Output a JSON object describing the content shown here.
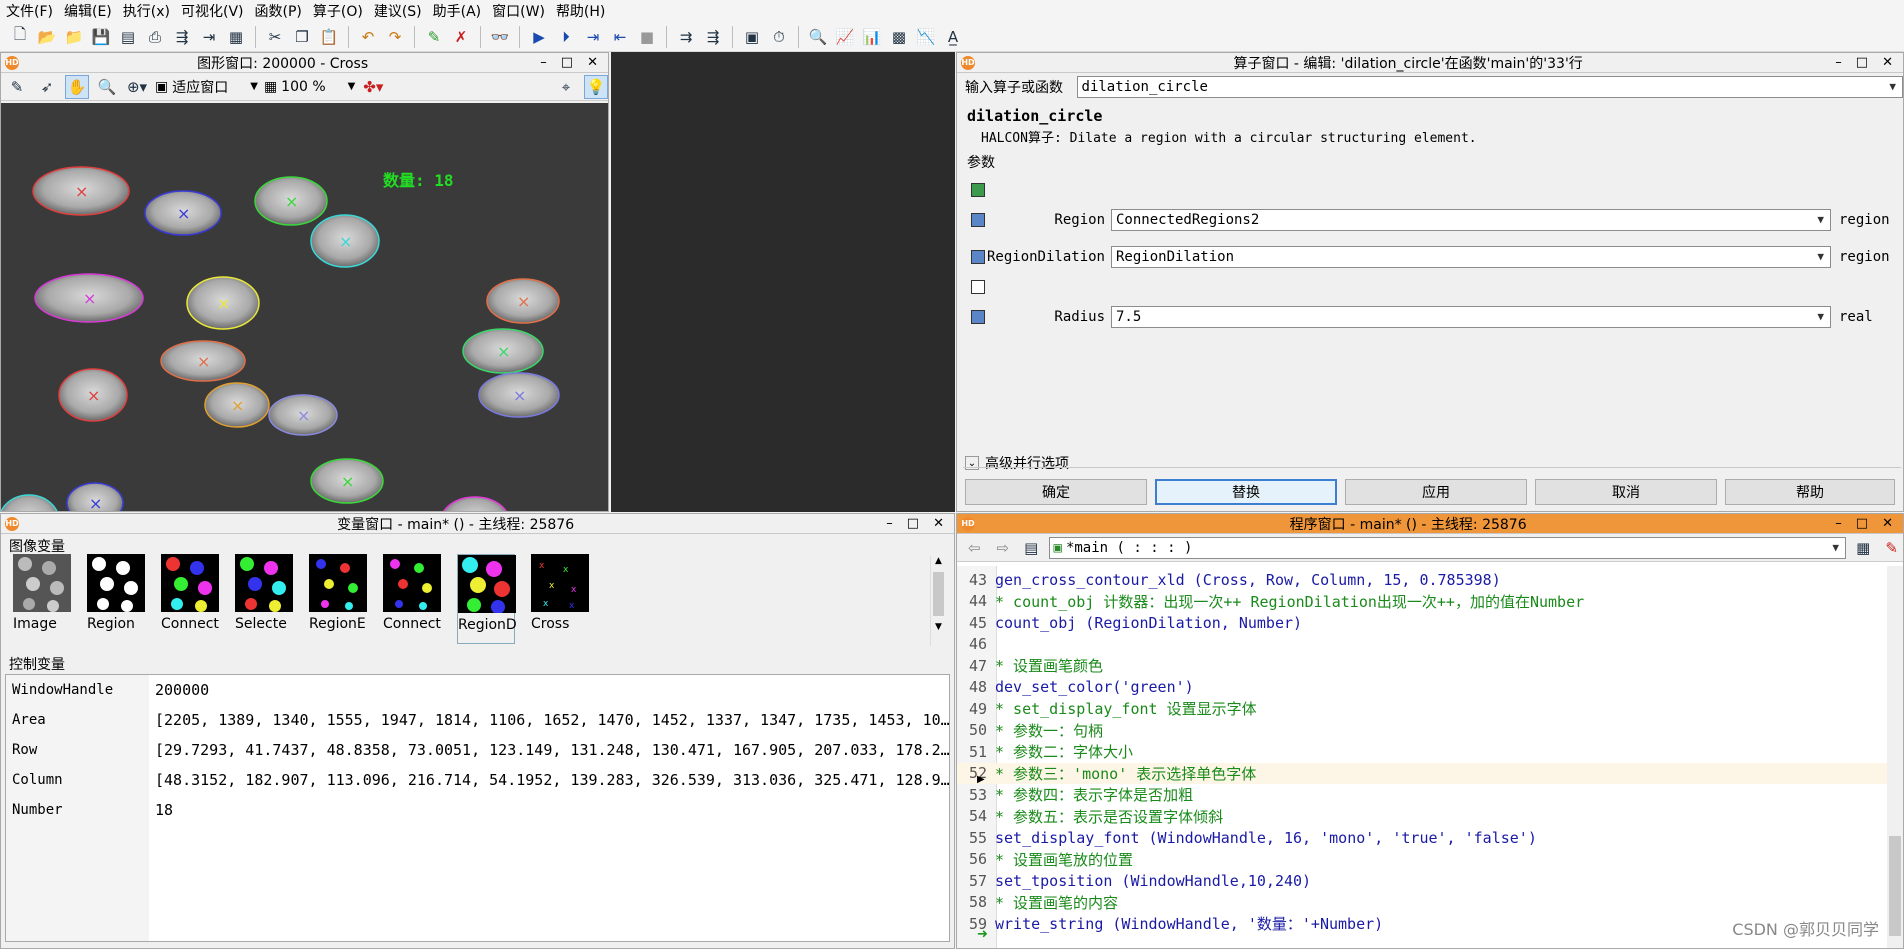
{
  "menu": [
    "文件(F)",
    "编辑(E)",
    "执行(x)",
    "可视化(V)",
    "函数(P)",
    "算子(O)",
    "建议(S)",
    "助手(A)",
    "窗口(W)",
    "帮助(H)"
  ],
  "toolbar_icons": [
    "new-file-icon",
    "open-icon",
    "open-example-icon",
    "save-icon",
    "save-all-icon",
    "print-icon",
    "program-icon",
    "run-icon",
    "cut-icon",
    "copy-icon",
    "paste-icon",
    "undo-icon",
    "redo-icon",
    "activate-icon",
    "deactivate-icon",
    "watch-icon",
    "run-icon",
    "step-over-icon",
    "step-into-icon",
    "step-out-icon",
    "stop-icon",
    "reset-icon",
    "reset-all-icon",
    "windows-icon",
    "timer-icon",
    "zoom-icon",
    "histogram-icon",
    "line-profile-icon",
    "gray-value-icon",
    "feature-icon",
    "ocr-icon"
  ],
  "graphics": {
    "title": "图形窗口: 200000 - Cross",
    "fit_label": "适应窗口",
    "zoom": "100 %",
    "overlay_text": "数量: 18",
    "overlay_color": "#22dd22"
  },
  "operator": {
    "title": "算子窗口 - 编辑: 'dilation_circle'在函数'main'的'33'行",
    "input_label": "输入算子或函数",
    "input_value": "dilation_circle",
    "name": "dilation_circle",
    "description": "HALCON算子: Dilate a region with a circular structuring element.",
    "params_heading": "参数",
    "params": [
      {
        "name": "Region",
        "value": "ConnectedRegions2",
        "type": "region"
      },
      {
        "name": "RegionDilation",
        "value": "RegionDilation",
        "type": "region"
      },
      {
        "name": "Radius",
        "value": "7.5",
        "type": "real"
      }
    ],
    "advanced_label": "高级并行选项",
    "buttons": [
      "确定",
      "替换",
      "应用",
      "取消",
      "帮助"
    ]
  },
  "variables": {
    "title": "变量窗口 - main* () - 主线程: 25876",
    "iconic_heading": "图像变量",
    "iconic": [
      "Image",
      "Region",
      "Connect",
      "Selecte",
      "RegionE",
      "Connect",
      "RegionD",
      "Cross"
    ],
    "control_heading": "控制变量",
    "control": [
      {
        "name": "WindowHandle",
        "value": "200000"
      },
      {
        "name": "Area",
        "value": "[2205, 1389, 1340, 1555, 1947, 1814, 1106, 1652, 1470, 1452, 1337, 1347, 1735, 1453, 10…"
      },
      {
        "name": "Row",
        "value": "[29.7293, 41.7437, 48.8358, 73.0051, 123.149, 131.248, 130.471, 167.905, 207.033, 178.2…"
      },
      {
        "name": "Column",
        "value": "[48.3152, 182.907, 113.096, 216.714, 54.1952, 139.283, 326.539, 313.036, 325.471, 128.9…"
      },
      {
        "name": "Number",
        "value": "18"
      }
    ]
  },
  "program": {
    "title": "程序窗口 - main* () - 主线程: 25876",
    "procedure": "*main ( : : : )",
    "lines": [
      {
        "n": "43",
        "kind": "op",
        "text": "gen_cross_contour_xld (Cross, Row, Column, 15, 0.785398)"
      },
      {
        "n": "44",
        "kind": "cm",
        "text": "* count_obj 计数器：出现一次++  RegionDilation出现一次++，加的值在Number"
      },
      {
        "n": "45",
        "kind": "op",
        "text": "count_obj (RegionDilation, Number)"
      },
      {
        "n": "46",
        "kind": "op",
        "text": ""
      },
      {
        "n": "47",
        "kind": "cm",
        "text": "* 设置画笔颜色"
      },
      {
        "n": "48",
        "kind": "op",
        "text": "dev_set_color('green')"
      },
      {
        "n": "49",
        "kind": "cm",
        "text": "* set_display_font 设置显示字体"
      },
      {
        "n": "50",
        "kind": "cm",
        "text": "* 参数一：句柄"
      },
      {
        "n": "51",
        "kind": "cm",
        "text": "* 参数二：字体大小"
      },
      {
        "n": "52",
        "kind": "cm",
        "text": "* 参数三：'mono' 表示选择单色字体"
      },
      {
        "n": "53",
        "kind": "cm",
        "text": "* 参数四：表示字体是否加粗"
      },
      {
        "n": "54",
        "kind": "cm",
        "text": "* 参数五：表示是否设置字体倾斜"
      },
      {
        "n": "55",
        "kind": "op",
        "text": "set_display_font (WindowHandle, 16, 'mono', 'true', 'false')"
      },
      {
        "n": "56",
        "kind": "cm",
        "text": "* 设置画笔放的位置"
      },
      {
        "n": "57",
        "kind": "op",
        "text": "set_tposition (WindowHandle,10,240)"
      },
      {
        "n": "58",
        "kind": "cm",
        "text": "* 设置画笔的内容"
      },
      {
        "n": "59",
        "kind": "op",
        "text": "write_string (WindowHandle, '数量：'+Number)"
      }
    ],
    "watermark": "CSDN @郭贝贝同学"
  }
}
